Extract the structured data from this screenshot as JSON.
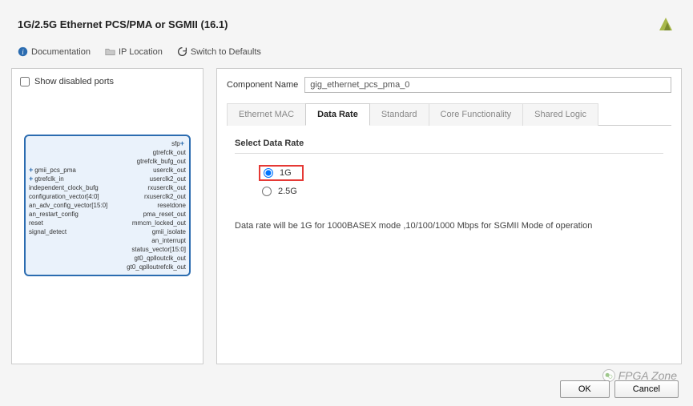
{
  "header": {
    "title": "1G/2.5G Ethernet PCS/PMA or SGMII (16.1)"
  },
  "toolbar": {
    "documentation": "Documentation",
    "ip_location": "IP Location",
    "switch_defaults": "Switch to Defaults"
  },
  "left_panel": {
    "show_disabled": "Show disabled ports",
    "inputs": [
      "gmii_pcs_pma",
      "gtrefclk_in",
      "independent_clock_bufg",
      "configuration_vector[4:0]",
      "an_adv_config_vector[15:0]",
      "an_restart_config",
      "reset",
      "signal_detect"
    ],
    "outputs": [
      "sfp",
      "gtrefclk_out",
      "gtrefclk_bufg_out",
      "userclk_out",
      "userclk2_out",
      "rxuserclk_out",
      "rxuserclk2_out",
      "resetdone",
      "pma_reset_out",
      "mmcm_locked_out",
      "gmii_isolate",
      "an_interrupt",
      "status_vector[15:0]",
      "gt0_qplloutclk_out",
      "gt0_qplloutrefclk_out"
    ]
  },
  "right_panel": {
    "component_label": "Component Name",
    "component_value": "gig_ethernet_pcs_pma_0",
    "tabs": [
      "Ethernet MAC",
      "Data Rate",
      "Standard",
      "Core Functionality",
      "Shared Logic"
    ],
    "active_tab": "Data Rate",
    "section": {
      "title": "Select Data Rate",
      "options": [
        {
          "label": "1G",
          "selected": true,
          "highlighted": true
        },
        {
          "label": "2.5G",
          "selected": false,
          "highlighted": false
        }
      ],
      "description": "Data rate will be 1G for 1000BASEX mode ,10/100/1000 Mbps for SGMII Mode of operation"
    }
  },
  "footer": {
    "ok": "OK",
    "cancel": "Cancel"
  },
  "watermark": "FPGA Zone"
}
